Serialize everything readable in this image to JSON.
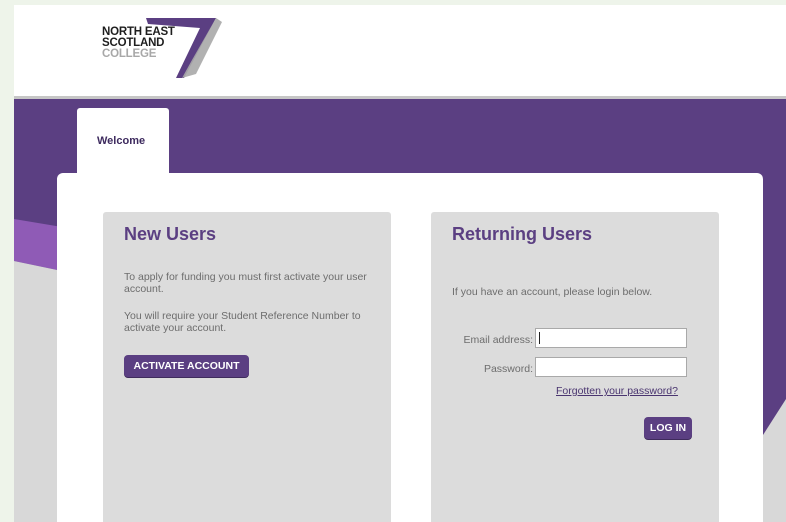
{
  "brand": {
    "logo_lines": [
      "NORTH EAST",
      "SCOTLAND",
      "COLLEGE"
    ],
    "colors": {
      "primary": "#5b3f82",
      "accent": "#8f5bb6",
      "panel": "#dcdcdc"
    }
  },
  "tabs": [
    {
      "label": "Welcome",
      "active": true
    }
  ],
  "new_users": {
    "title": "New Users",
    "text1": "To apply for funding you must first activate your user account.",
    "text2": "You will require your Student Reference Number to activate your account.",
    "button": "ACTIVATE ACCOUNT"
  },
  "returning_users": {
    "title": "Returning Users",
    "intro": "If you have an account, please login below.",
    "email_label": "Email address:",
    "email_value": "",
    "password_label": "Password:",
    "password_value": "",
    "forgot_link": "Forgotten your password?",
    "button": "LOG IN"
  }
}
